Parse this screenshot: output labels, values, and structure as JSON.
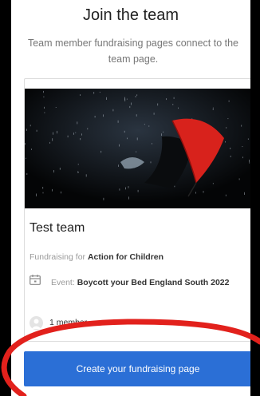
{
  "header": {
    "title": "Join the team",
    "subtitle": "Team member fundraising pages connect to the team page."
  },
  "team": {
    "name": "Test team",
    "fundraising_prefix": "Fundraising for",
    "charity": "Action for Children",
    "event_label": "Event:",
    "event_name": "Boycott your Bed England South 2022",
    "members": "1 member",
    "image_subject": "person-with-red-umbrella-in-rain"
  },
  "actions": {
    "create_label": "Create your fundraising page"
  },
  "colors": {
    "primary": "#2b6fd6",
    "annotation": "#e2211c",
    "umbrella": "#d8221c"
  },
  "icons": {
    "event": "calendar-icon",
    "members": "user-avatar-icon"
  }
}
